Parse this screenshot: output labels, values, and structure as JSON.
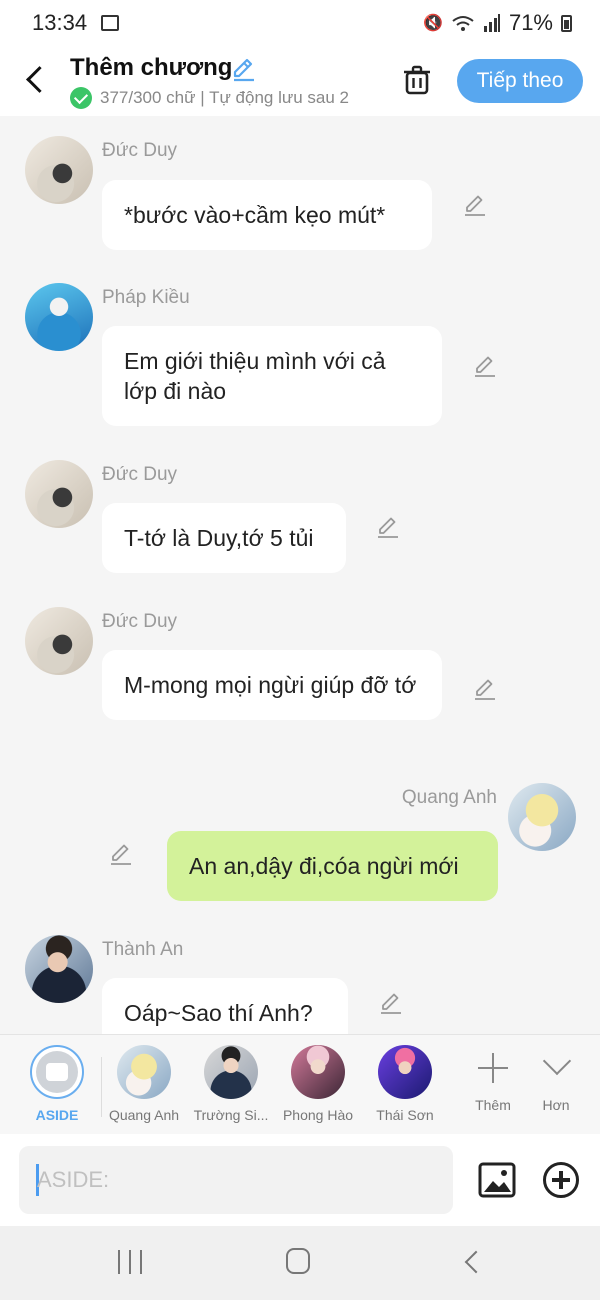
{
  "status_bar": {
    "time": "13:34",
    "battery": "71%"
  },
  "header": {
    "title": "Thêm chương",
    "save_status": "377/300 chữ | Tự động lưu sau 2",
    "next_label": "Tiếp theo"
  },
  "messages": [
    {
      "author": "Đức Duy",
      "text": "*bước vào+cầm kẹo mút*",
      "side": "left"
    },
    {
      "author": "Pháp Kiều",
      "text": "Em giới thiệu mình với cả lớp đi nào",
      "side": "left"
    },
    {
      "author": "Đức Duy",
      "text": "T-tớ là Duy,tớ 5 tủi",
      "side": "left"
    },
    {
      "author": "Đức Duy",
      "text": "M-mong mọi ngừi giúp đỡ tớ",
      "side": "left"
    },
    {
      "author": "Quang Anh",
      "text": "An an,dậy đi,cóa ngừi mới",
      "side": "right"
    },
    {
      "author": "Thành An",
      "text": "Oáp~Sao thí Anh?",
      "side": "left"
    }
  ],
  "characters": {
    "aside_label": "ASIDE",
    "items": [
      "Quang Anh",
      "Trường Si...",
      "Phong Hào",
      "Thái Sơn"
    ],
    "add_label": "Thêm",
    "more_label": "Hơn"
  },
  "composer": {
    "placeholder": "ASIDE:"
  },
  "colors": {
    "accent": "#58a7ef",
    "own_bubble": "#d3f29a",
    "success": "#3bc567"
  }
}
